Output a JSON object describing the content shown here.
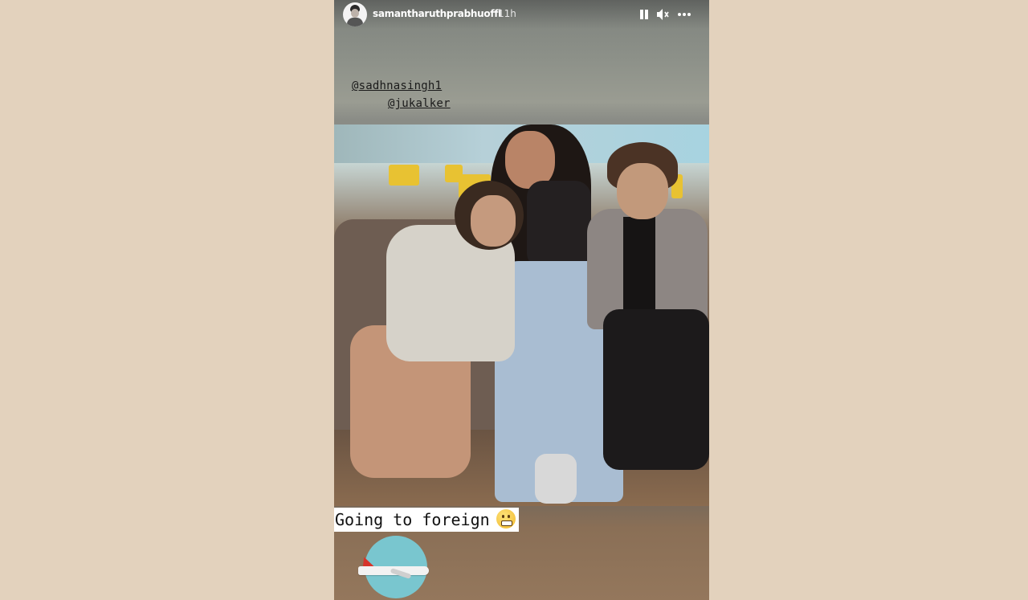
{
  "story": {
    "username": "samantharuthprabhuoffl",
    "timestamp": "11h",
    "controls": {
      "pause_icon": "pause-icon",
      "sound_icon": "speaker-icon",
      "more_icon": "more-options-icon"
    },
    "mentions": [
      "@sadhnasingh1",
      "@jukalker"
    ],
    "caption": "Going to foreign",
    "caption_emoji": "grimacing-face-icon",
    "sticker": "airplane-sticker-icon"
  },
  "colors": {
    "page_background": "#e3d2bd",
    "header_text": "#ffffff",
    "caption_background": "#ffffff",
    "sticker_circle": "#79c6cf"
  }
}
